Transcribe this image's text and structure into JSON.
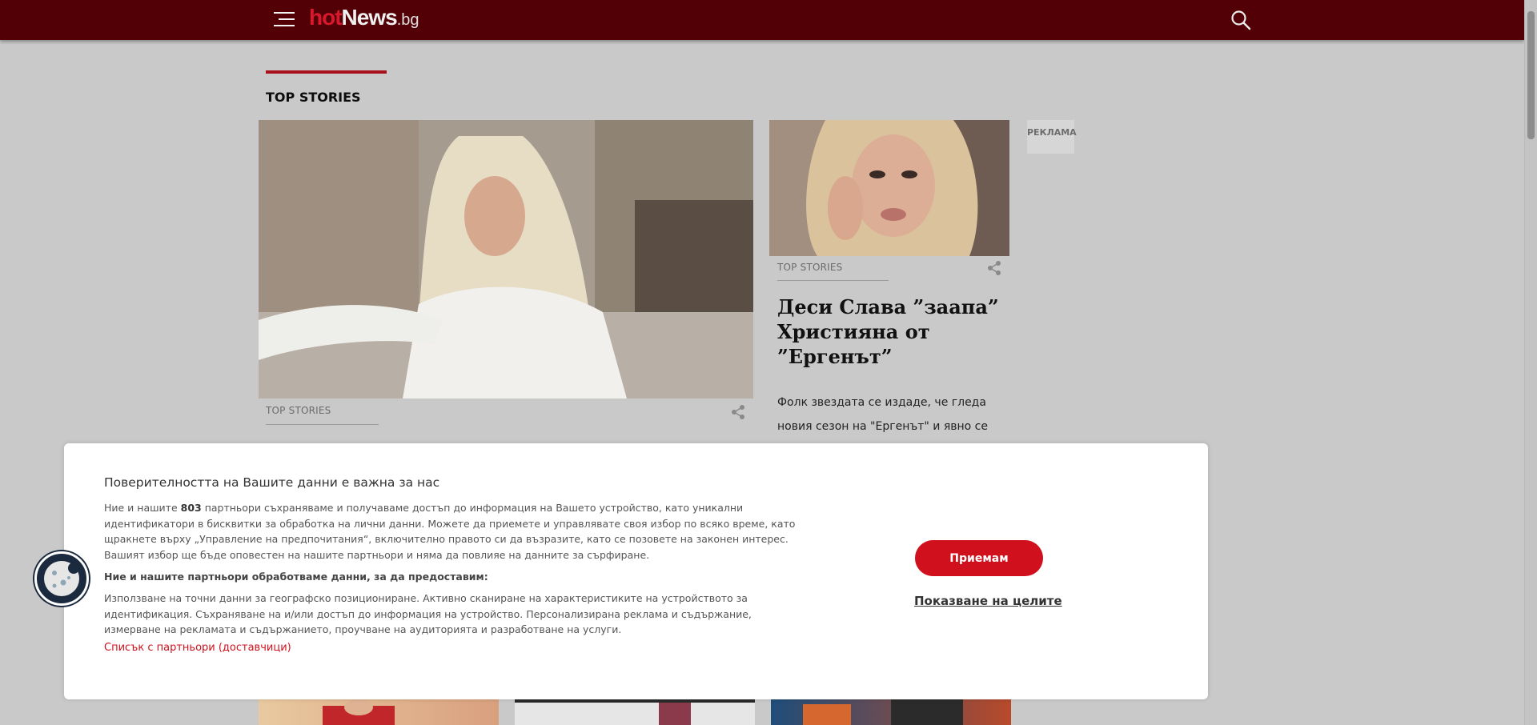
{
  "header": {
    "logo_hot": "hot",
    "logo_news": "News",
    "logo_tld": ".bg"
  },
  "section": {
    "title": "TOP STORIES"
  },
  "hero": {
    "category": "TOP STORIES"
  },
  "side_article": {
    "category": "TOP STORIES",
    "headline": "Деси Слава ”зaапа” Християна от ”Ергенът”",
    "excerpt": "Фолк звездата се издаде, че гледа новия сезон на \"Ергенът\" и явно се забавлява"
  },
  "ad": {
    "label": "РЕКЛАМА"
  },
  "consent": {
    "title": "Поверителността на Вашите данни е важна за нас",
    "intro_before": "Ние и нашите ",
    "partner_count": "803",
    "intro_after": " партньори съхраняваме и получаваме достъп до информация на Вашето устройство, като уникални идентификатори в бисквитки за обработка на лични данни. Можете да приемете и управлявате своя избор по всяко време, като щракнете върху „Управление на предпочитания“, включително правото си да възразите, като се позовете на законен интерес. Вашият избор ще бъде оповестен на нашите партньори и няма да повлияе на данните за сърфиране.",
    "subtitle": "Ние и нашите партньори обработваме данни, за да предоставим:",
    "purposes": "Използване на точни данни за географско позициониране. Активно сканиране на характеристиките на устройството за идентификация. Съхраняване на и/или достъп до информация на устройство. Персонализирана реклама и съдържание, измерване на рекламата и съдържанието, проучване на аудиторията и разработване на услуги.",
    "partners_link": "Списък с партньори (доставчици)",
    "accept_label": "Приемам",
    "show_purposes_label": "Показване на целите"
  },
  "icons": {
    "menu": "hamburger-menu-icon",
    "search": "search-icon",
    "share": "share-icon",
    "cookie": "cookie-icon"
  },
  "colors": {
    "header_bg": "#520006",
    "brand_red": "#d0101d",
    "section_accent": "#a8101c",
    "page_bg": "#c9c9c9"
  }
}
